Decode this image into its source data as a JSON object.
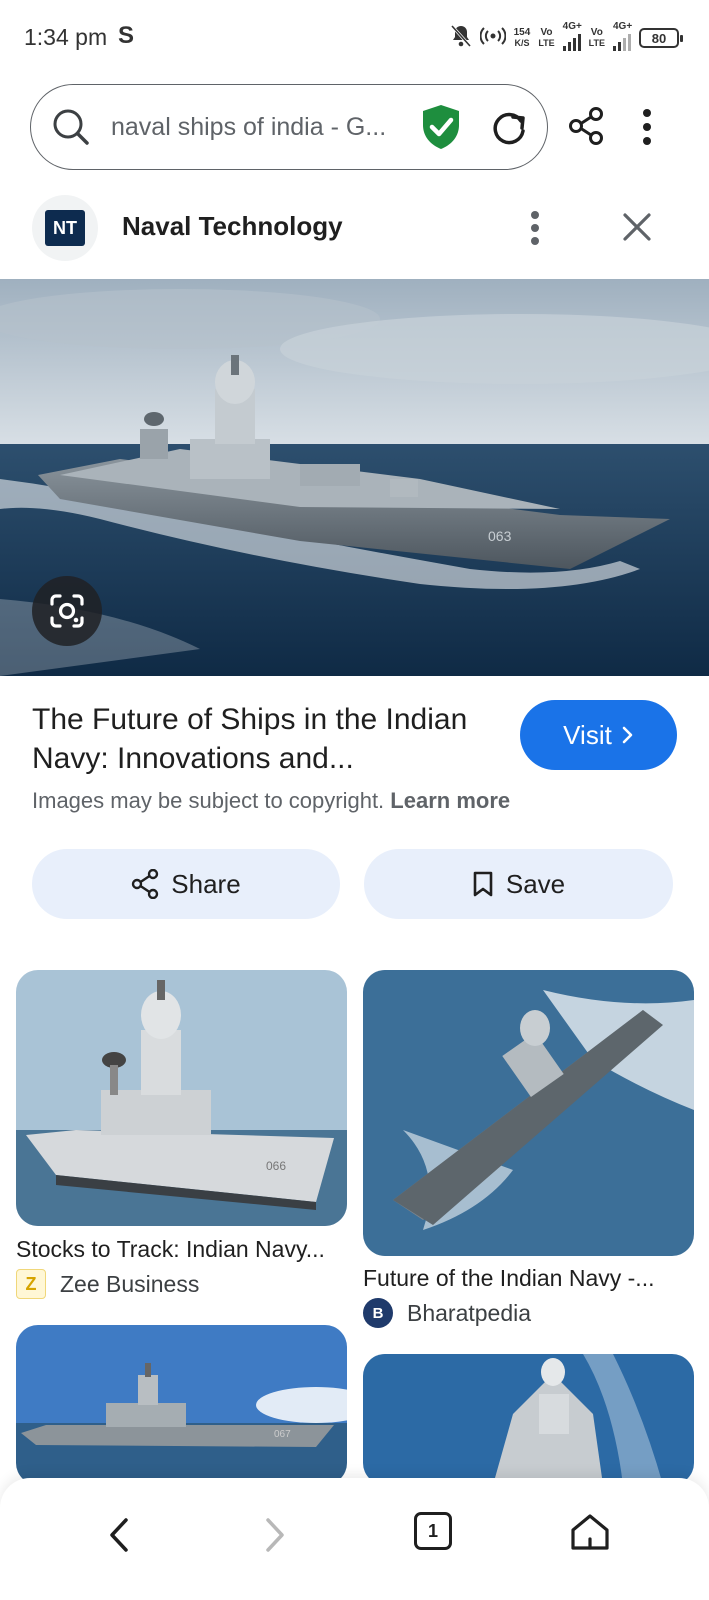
{
  "status_bar": {
    "time": "1:34 pm",
    "carrier_icon": "S",
    "speed_value": "154",
    "speed_unit": "K/S",
    "net1_top": "Vo",
    "net1_bottom": "LTE",
    "net1_type": "4G+",
    "net2_top": "Vo",
    "net2_bottom": "LTE",
    "net2_type": "4G+",
    "battery": "80"
  },
  "search": {
    "query": "naval ships of india - G..."
  },
  "source": {
    "avatar_text": "NT",
    "name": "Naval Technology"
  },
  "result": {
    "title": "The Future of Ships in the Indian Navy: Innovations and...",
    "visit_label": "Visit",
    "copyright_text": "Images may be subject to copyright.",
    "learn_more": "Learn more",
    "share_label": "Share",
    "save_label": "Save",
    "hero_hull_number": "063"
  },
  "related": [
    {
      "caption": "Stocks to Track: Indian Navy...",
      "site": "Zee Business",
      "favicon_text": "Z",
      "hull": "066"
    },
    {
      "caption": "Future of the Indian Navy -...",
      "site": "Bharatpedia",
      "favicon_text": "B",
      "hull": ""
    },
    {
      "caption": "",
      "site": "",
      "favicon_text": "",
      "hull": "067"
    },
    {
      "caption": "",
      "site": "",
      "favicon_text": "",
      "hull": ""
    }
  ],
  "bottom_nav": {
    "tab_count": "1"
  },
  "colors": {
    "accent": "#1a73e8",
    "action_bg": "#e8effb",
    "shield": "#1e8e3e"
  }
}
